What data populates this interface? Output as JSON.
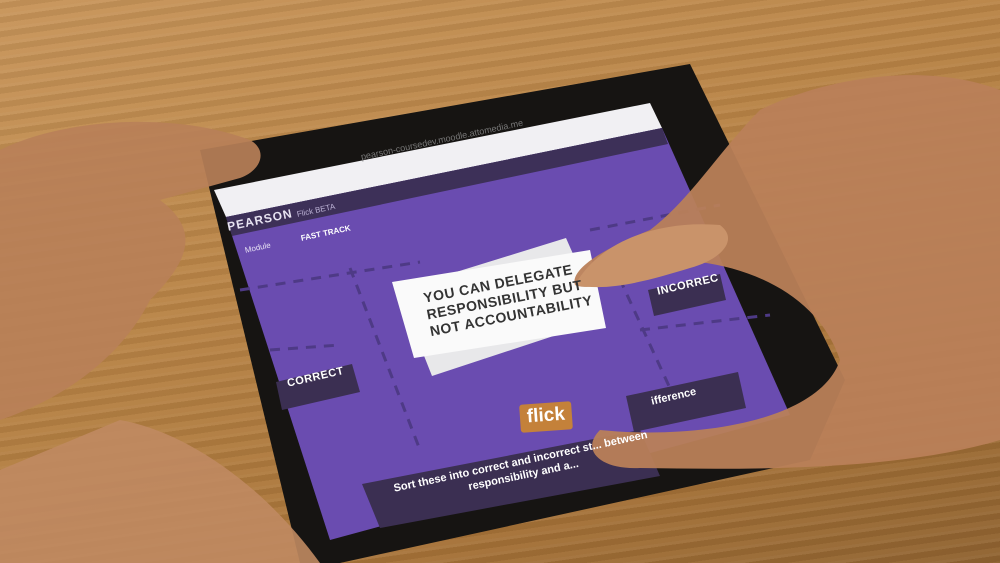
{
  "browser": {
    "url": "pearson-coursedev.moodle.attomedia.me"
  },
  "header": {
    "brand": "PEARSON",
    "beta": "Flick BETA"
  },
  "toolbar": {
    "module_label": "Module",
    "fast_track_label": "FAST TRACK"
  },
  "card": {
    "text": "YOU CAN DELEGATE RESPONSIBILITY BUT NOT ACCOUNTABILITY"
  },
  "zones": {
    "correct": "CORRECT",
    "incorrect": "INCORREC",
    "difference": "ifference"
  },
  "instruction": {
    "text": "Sort these into correct and incorrect st... between responsibility and a..."
  },
  "brand_badge": {
    "label": "flick"
  },
  "colors": {
    "screen_purple": "#6a4cb0",
    "dark_panel": "#3b2f52",
    "flick_orange": "#c4813a",
    "table_wood": "#b98446"
  }
}
